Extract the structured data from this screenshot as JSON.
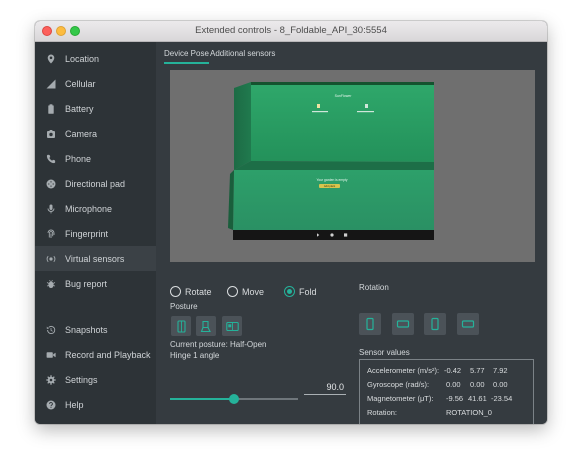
{
  "window": {
    "title": "Extended controls - 8_Foldable_API_30:5554"
  },
  "sidebar": {
    "items": [
      {
        "label": "Location",
        "icon": "location-pin-icon"
      },
      {
        "label": "Cellular",
        "icon": "signal-icon"
      },
      {
        "label": "Battery",
        "icon": "battery-icon"
      },
      {
        "label": "Camera",
        "icon": "camera-icon"
      },
      {
        "label": "Phone",
        "icon": "phone-icon"
      },
      {
        "label": "Directional pad",
        "icon": "dpad-icon"
      },
      {
        "label": "Microphone",
        "icon": "microphone-icon"
      },
      {
        "label": "Fingerprint",
        "icon": "fingerprint-icon"
      },
      {
        "label": "Virtual sensors",
        "icon": "sensors-icon",
        "active": true
      },
      {
        "label": "Bug report",
        "icon": "bug-icon"
      },
      {
        "label": "Snapshots",
        "icon": "history-icon"
      },
      {
        "label": "Record and Playback",
        "icon": "record-icon"
      },
      {
        "label": "Settings",
        "icon": "gear-icon"
      },
      {
        "label": "Help",
        "icon": "help-icon"
      }
    ]
  },
  "tabs": [
    {
      "label": "Device Pose",
      "active": true
    },
    {
      "label": "Additional sensors",
      "active": false
    }
  ],
  "device_preview": {
    "screen_title": "SunFlower",
    "screen_prompt": "Your garden is empty",
    "screen_button": "Add plant"
  },
  "modes": [
    {
      "label": "Rotate",
      "selected": false
    },
    {
      "label": "Move",
      "selected": false
    },
    {
      "label": "Fold",
      "selected": true
    }
  ],
  "posture": {
    "label": "Posture",
    "current_text": "Current posture: Half-Open",
    "hinge_label": "Hinge 1 angle",
    "hinge_value": "90.0",
    "hinge_fraction": 0.5,
    "icons": [
      "posture-closed-icon",
      "posture-half-open-icon",
      "posture-open-icon"
    ]
  },
  "rotation": {
    "label": "Rotation",
    "icons": [
      "portrait-icon",
      "landscape-icon",
      "reverse-portrait-icon",
      "reverse-landscape-icon"
    ]
  },
  "sensor_values": {
    "label": "Sensor values",
    "rows": [
      {
        "name": "Accelerometer (m/s²):",
        "values": [
          "-0.42",
          "5.77",
          "7.92"
        ]
      },
      {
        "name": "Gyroscope (rad/s):",
        "values": [
          "0.00",
          "0.00",
          "0.00"
        ]
      },
      {
        "name": "Magnetometer (μT):",
        "values": [
          "-9.56",
          "41.61",
          "-23.54"
        ]
      },
      {
        "name": "Rotation:",
        "values": [
          "ROTATION_0"
        ]
      }
    ]
  },
  "colors": {
    "accent": "#25b29a",
    "sidebar_bg": "#2d3337",
    "panel_bg": "#353b40",
    "device_green": "#2a9f67"
  }
}
